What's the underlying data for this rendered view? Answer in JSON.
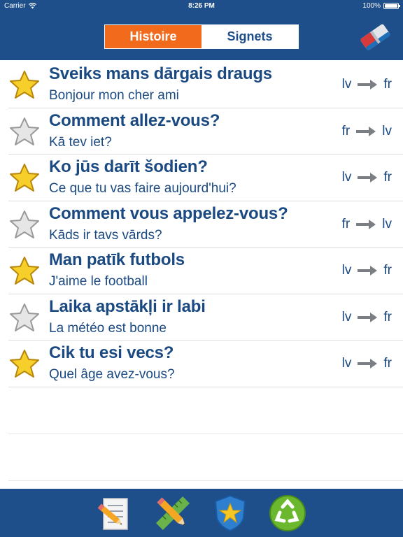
{
  "status": {
    "carrier": "Carrier",
    "time": "8:26 PM",
    "battery": "100%"
  },
  "tabs": [
    {
      "label": "Histoire",
      "active": true
    },
    {
      "label": "Signets",
      "active": false
    }
  ],
  "colors": {
    "header": "#1f4f8a",
    "accent": "#f26a1b",
    "text": "#1b4a82"
  },
  "items": [
    {
      "primary": "Sveiks mans dārgais draugs",
      "secondary": "Bonjour mon cher ami",
      "from": "lv",
      "to": "fr",
      "starred": true
    },
    {
      "primary": "Comment allez-vous?",
      "secondary": "Kā tev iet?",
      "from": "fr",
      "to": "lv",
      "starred": false
    },
    {
      "primary": "Ko jūs darīt šodien?",
      "secondary": "Ce que tu vas faire aujourd'hui?",
      "from": "lv",
      "to": "fr",
      "starred": true
    },
    {
      "primary": "Comment vous appelez-vous?",
      "secondary": "Kāds ir tavs vārds?",
      "from": "fr",
      "to": "lv",
      "starred": false
    },
    {
      "primary": "Man patīk futbols",
      "secondary": "J'aime le football",
      "from": "lv",
      "to": "fr",
      "starred": true
    },
    {
      "primary": "Laika apstākļi ir labi",
      "secondary": "La météo est bonne",
      "from": "lv",
      "to": "fr",
      "starred": false
    },
    {
      "primary": "Cik tu esi vecs?",
      "secondary": "Quel âge avez-vous?",
      "from": "lv",
      "to": "fr",
      "starred": true
    }
  ],
  "toolbar": {
    "icons": [
      "notepad-pencil-icon",
      "ruler-pencil-icon",
      "star-shield-icon",
      "recycle-icon"
    ]
  }
}
